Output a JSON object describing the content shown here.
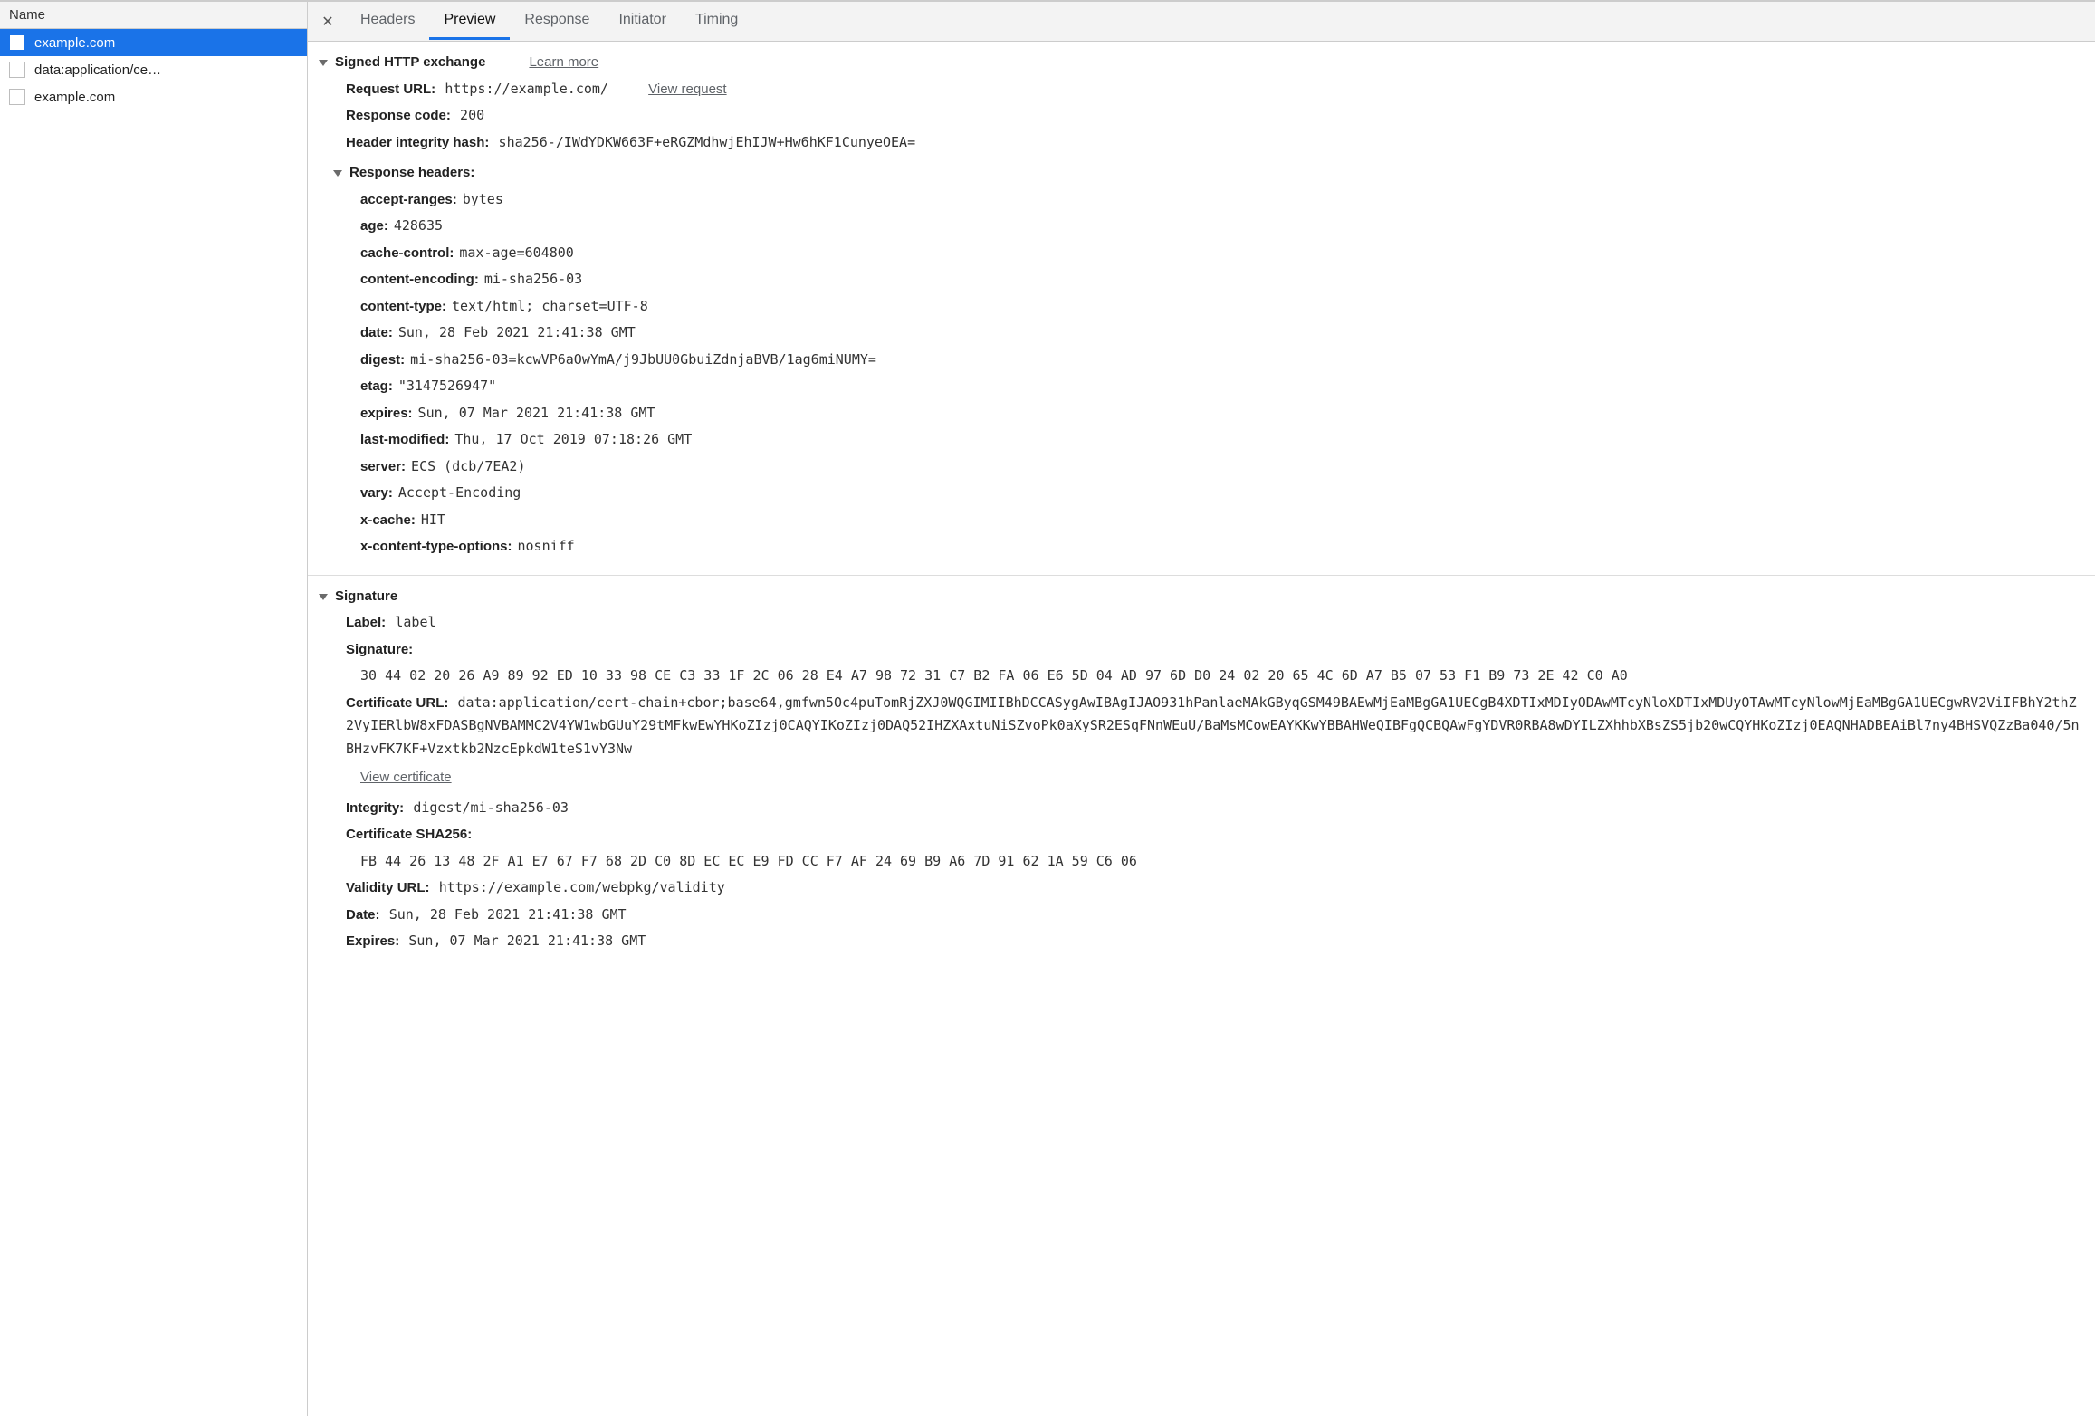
{
  "sidebar": {
    "header": "Name",
    "items": [
      {
        "label": "example.com",
        "selected": true
      },
      {
        "label": "data:application/ce…",
        "selected": false
      },
      {
        "label": "example.com",
        "selected": false
      }
    ]
  },
  "tabs": {
    "items": [
      {
        "label": "Headers",
        "active": false
      },
      {
        "label": "Preview",
        "active": true
      },
      {
        "label": "Response",
        "active": false
      },
      {
        "label": "Initiator",
        "active": false
      },
      {
        "label": "Timing",
        "active": false
      }
    ]
  },
  "signedExchange": {
    "title": "Signed HTTP exchange",
    "learnMore": "Learn more",
    "requestUrlKey": "Request URL:",
    "requestUrlVal": "https://example.com/",
    "viewRequest": "View request",
    "responseCodeKey": "Response code:",
    "responseCodeVal": "200",
    "headerIntegrityKey": "Header integrity hash:",
    "headerIntegrityVal": "sha256-/IWdYDKW663F+eRGZMdhwjEhIJW+Hw6hKF1CunyeOEA=",
    "responseHeadersTitle": "Response headers:",
    "responseHeaders": [
      {
        "k": "accept-ranges:",
        "v": "bytes"
      },
      {
        "k": "age:",
        "v": "428635"
      },
      {
        "k": "cache-control:",
        "v": "max-age=604800"
      },
      {
        "k": "content-encoding:",
        "v": "mi-sha256-03"
      },
      {
        "k": "content-type:",
        "v": "text/html; charset=UTF-8"
      },
      {
        "k": "date:",
        "v": "Sun, 28 Feb 2021 21:41:38 GMT"
      },
      {
        "k": "digest:",
        "v": "mi-sha256-03=kcwVP6aOwYmA/j9JbUU0GbuiZdnjaBVB/1ag6miNUMY="
      },
      {
        "k": "etag:",
        "v": "\"3147526947\""
      },
      {
        "k": "expires:",
        "v": "Sun, 07 Mar 2021 21:41:38 GMT"
      },
      {
        "k": "last-modified:",
        "v": "Thu, 17 Oct 2019 07:18:26 GMT"
      },
      {
        "k": "server:",
        "v": "ECS (dcb/7EA2)"
      },
      {
        "k": "vary:",
        "v": "Accept-Encoding"
      },
      {
        "k": "x-cache:",
        "v": "HIT"
      },
      {
        "k": "x-content-type-options:",
        "v": "nosniff"
      }
    ]
  },
  "signature": {
    "title": "Signature",
    "labelKey": "Label:",
    "labelVal": "label",
    "signatureKey": "Signature:",
    "signatureVal": "30 44 02 20 26 A9 89 92 ED 10 33 98 CE C3 33 1F 2C 06 28 E4 A7 98 72 31 C7 B2 FA 06 E6 5D 04 AD 97 6D D0 24 02 20 65 4C 6D A7 B5 07 53 F1 B9 73 2E 42 C0 A0",
    "certUrlKey": "Certificate URL:",
    "certUrlVal": "data:application/cert-chain+cbor;base64,gmfwn5Oc4puTomRjZXJ0WQGIMIIBhDCCASygAwIBAgIJAO931hPanlaeMAkGByqGSM49BAEwMjEaMBgGA1UECgB4XDTIxMDIyODAwMTcyNloXDTIxMDUyOTAwMTcyNlowMjEaMBgGA1UECgwRV2ViIFBhY2thZ2VyIERlbW8xFDASBgNVBAMMC2V4YW1wbGUuY29tMFkwEwYHKoZIzj0CAQYIKoZIzj0DAQ52IHZXAxtuNiSZvoPk0aXySR2ESqFNnWEuU/BaMsMCowEAYKKwYBBAHWeQIBFgQCBQAwFgYDVR0RBA8wDYILZXhhbXBsZS5jb20wCQYHKoZIzj0EAQNHADBEAiBl7ny4BHSVQZzBa040/5nBHzvFK7KF+Vzxtkb2NzcEpkdW1teS1vY3Nw",
    "viewCert": "View certificate",
    "integrityKey": "Integrity:",
    "integrityVal": "digest/mi-sha256-03",
    "certShaKey": "Certificate SHA256:",
    "certShaVal": "FB 44 26 13 48 2F A1 E7 67 F7 68 2D C0 8D EC EC E9 FD CC F7 AF 24 69 B9 A6 7D 91 62 1A 59 C6 06",
    "validityUrlKey": "Validity URL:",
    "validityUrlVal": "https://example.com/webpkg/validity",
    "dateKey": "Date:",
    "dateVal": "Sun, 28 Feb 2021 21:41:38 GMT",
    "expiresKey": "Expires:",
    "expiresVal": "Sun, 07 Mar 2021 21:41:38 GMT"
  }
}
